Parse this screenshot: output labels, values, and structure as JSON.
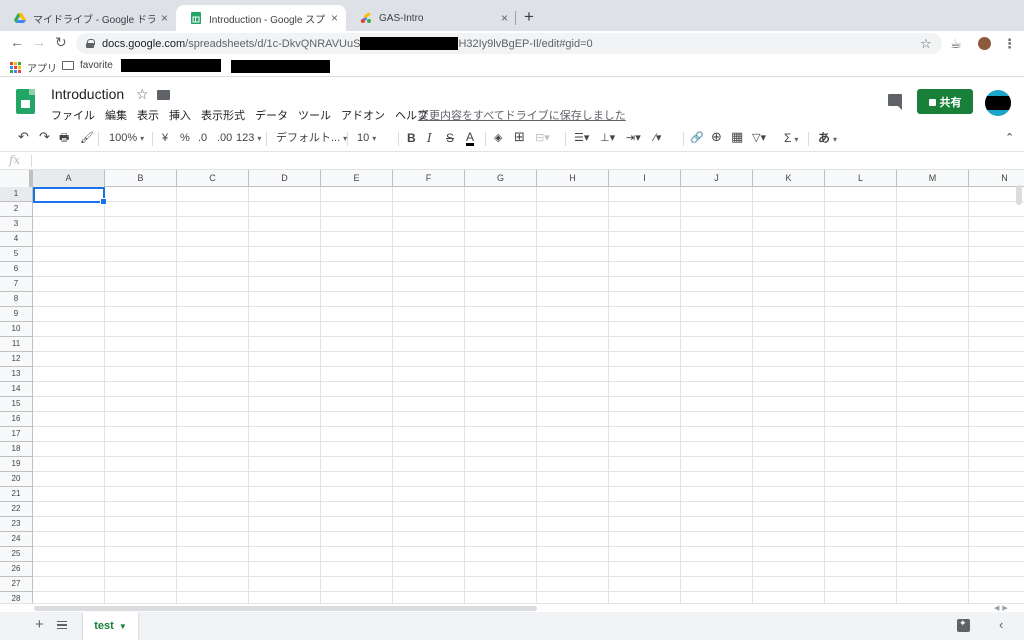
{
  "browser": {
    "tabs": [
      {
        "title": "マイドライブ - Google ドライブ",
        "close": "×"
      },
      {
        "title": "Introduction - Google スプレッ",
        "close": "×"
      },
      {
        "title": "GAS-Intro",
        "close": "×"
      }
    ],
    "new_tab": "+",
    "url_host": "docs.google.com",
    "url_path_start": "/spreadsheets/d/1c-DkvQNRAVUuS",
    "url_path_end": "H32Iy9lvBgEP-Il/edit#gid=0",
    "bookmarks": {
      "apps": "アプリ",
      "favorite": "favorite"
    }
  },
  "app": {
    "title": "Introduction",
    "menu": [
      "ファイル",
      "編集",
      "表示",
      "挿入",
      "表示形式",
      "データ",
      "ツール",
      "アドオン",
      "ヘルプ"
    ],
    "save_status": "変更内容をすべてドライブに保存しました",
    "share_label": "共有"
  },
  "toolbar": {
    "zoom": "100%",
    "currency": "¥",
    "percent": "%",
    "decimal_decrease": ".0",
    "decimal_increase": ".00",
    "more_formats": "123",
    "font": "デフォルト...",
    "font_size": "10",
    "bold": "B",
    "italic": "I",
    "strike": "S",
    "text_color": "A",
    "sum": "Σ",
    "input_tools": "あ"
  },
  "formula_bar": {
    "fx": "fx"
  },
  "grid": {
    "columns": [
      "A",
      "B",
      "C",
      "D",
      "E",
      "F",
      "G",
      "H",
      "I",
      "J",
      "K",
      "L",
      "M",
      "N"
    ],
    "rows": [
      "1",
      "2",
      "3",
      "4",
      "5",
      "6",
      "7",
      "8",
      "9",
      "10",
      "11",
      "12",
      "13",
      "14",
      "15",
      "16",
      "17",
      "18",
      "19",
      "20",
      "21",
      "22",
      "23",
      "24",
      "25",
      "26",
      "27",
      "28"
    ],
    "selected_cell": "A1"
  },
  "sheets": {
    "add": "+",
    "active_tab": "test"
  },
  "colors": {
    "accent": "#188038",
    "selection": "#1a73e8",
    "sheets_green": "#23a566"
  }
}
